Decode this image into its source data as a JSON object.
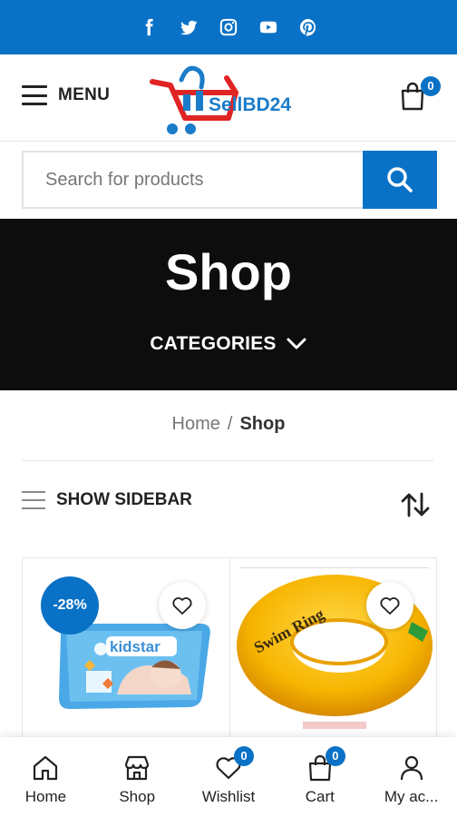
{
  "social": [
    {
      "icon": "facebook-icon"
    },
    {
      "icon": "twitter-icon"
    },
    {
      "icon": "instagram-icon"
    },
    {
      "icon": "youtube-icon"
    },
    {
      "icon": "pinterest-icon"
    }
  ],
  "header": {
    "menu_label": "MENU",
    "logo_text": "SellBD24",
    "cart_count": "0"
  },
  "search": {
    "placeholder": "Search for products",
    "value": ""
  },
  "hero": {
    "title": "Shop",
    "categories_label": "CATEGORIES"
  },
  "breadcrumb": {
    "home": "Home",
    "separator": "/",
    "current": "Shop"
  },
  "toolbar": {
    "sidebar_label": "SHOW SIDEBAR"
  },
  "products": [
    {
      "discount": "-28%",
      "image_text": "kidstar"
    },
    {
      "discount": "",
      "image_text": "Swim Ring"
    }
  ],
  "bottom_nav": [
    {
      "label": "Home",
      "icon": "home-icon"
    },
    {
      "label": "Shop",
      "icon": "store-icon"
    },
    {
      "label": "Wishlist",
      "icon": "heart-icon",
      "badge": "0"
    },
    {
      "label": "Cart",
      "icon": "bag-icon",
      "badge": "0"
    },
    {
      "label": "My ac...",
      "icon": "user-icon"
    }
  ],
  "colors": {
    "accent": "#0a72c6",
    "hero_bg": "#0d0d0d",
    "logo_red": "#e02424"
  }
}
